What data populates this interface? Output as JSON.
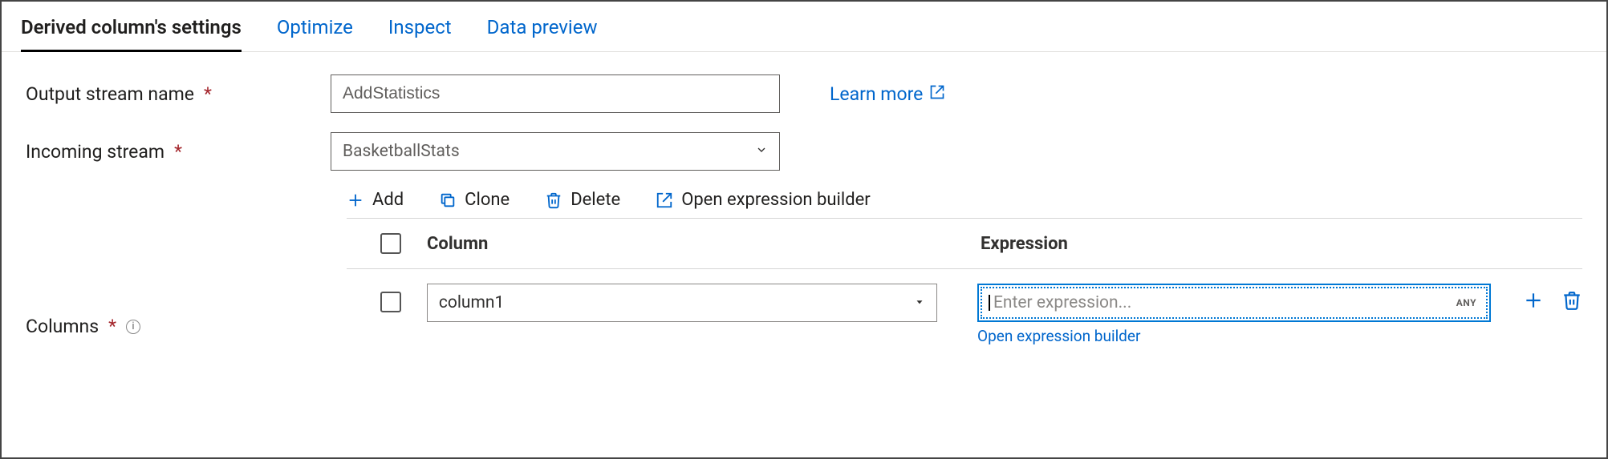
{
  "tabs": {
    "settings": "Derived column's settings",
    "optimize": "Optimize",
    "inspect": "Inspect",
    "preview": "Data preview"
  },
  "labels": {
    "output_stream": "Output stream name",
    "incoming_stream": "Incoming stream",
    "columns": "Columns"
  },
  "fields": {
    "output_stream_value": "AddStatistics",
    "incoming_stream_value": "BasketballStats"
  },
  "links": {
    "learn_more": "Learn more",
    "open_expression_builder": "Open expression builder"
  },
  "toolbar": {
    "add": "Add",
    "clone": "Clone",
    "delete": "Delete",
    "open_builder": "Open expression builder"
  },
  "table": {
    "header_column": "Column",
    "header_expression": "Expression",
    "rows": [
      {
        "column_name": "column1",
        "expression_placeholder": "Enter expression...",
        "type_badge": "ANY"
      }
    ]
  }
}
